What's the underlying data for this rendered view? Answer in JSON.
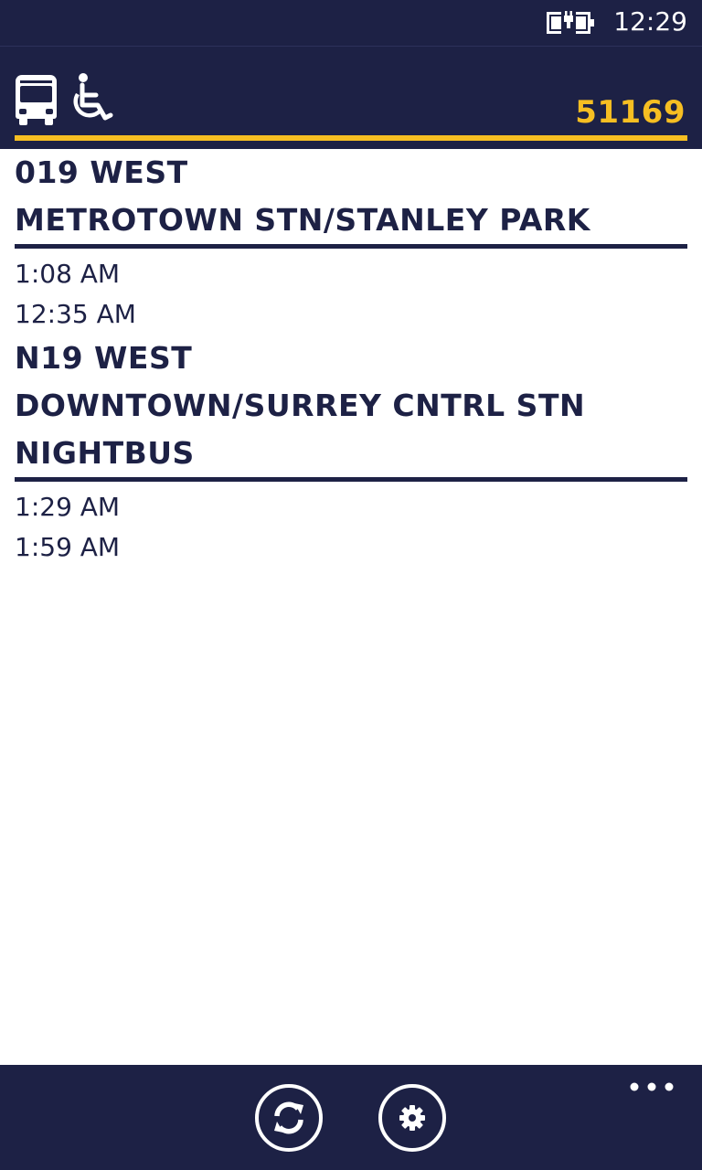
{
  "status_bar": {
    "time": "12:29",
    "battery_icon": "battery-charging-icon"
  },
  "header": {
    "bus_icon": "bus-icon",
    "wheelchair_icon": "wheelchair-icon",
    "stop_number": "51169",
    "accent_color": "#f6be22",
    "background_color": "#1d2145"
  },
  "routes": [
    {
      "title_lines": [
        "019 WEST",
        "METROTOWN STN/STANLEY PARK"
      ],
      "times": [
        "1:08 AM",
        "12:35 AM"
      ]
    },
    {
      "title_lines": [
        "N19 WEST",
        "DOWNTOWN/SURREY CNTRL STN",
        "NIGHTBUS"
      ],
      "times": [
        "1:29 AM",
        "1:59 AM"
      ]
    }
  ],
  "app_bar": {
    "buttons": [
      {
        "name": "refresh",
        "icon": "refresh-icon"
      },
      {
        "name": "settings",
        "icon": "gear-icon"
      }
    ],
    "more_icon": "ellipsis-icon"
  }
}
